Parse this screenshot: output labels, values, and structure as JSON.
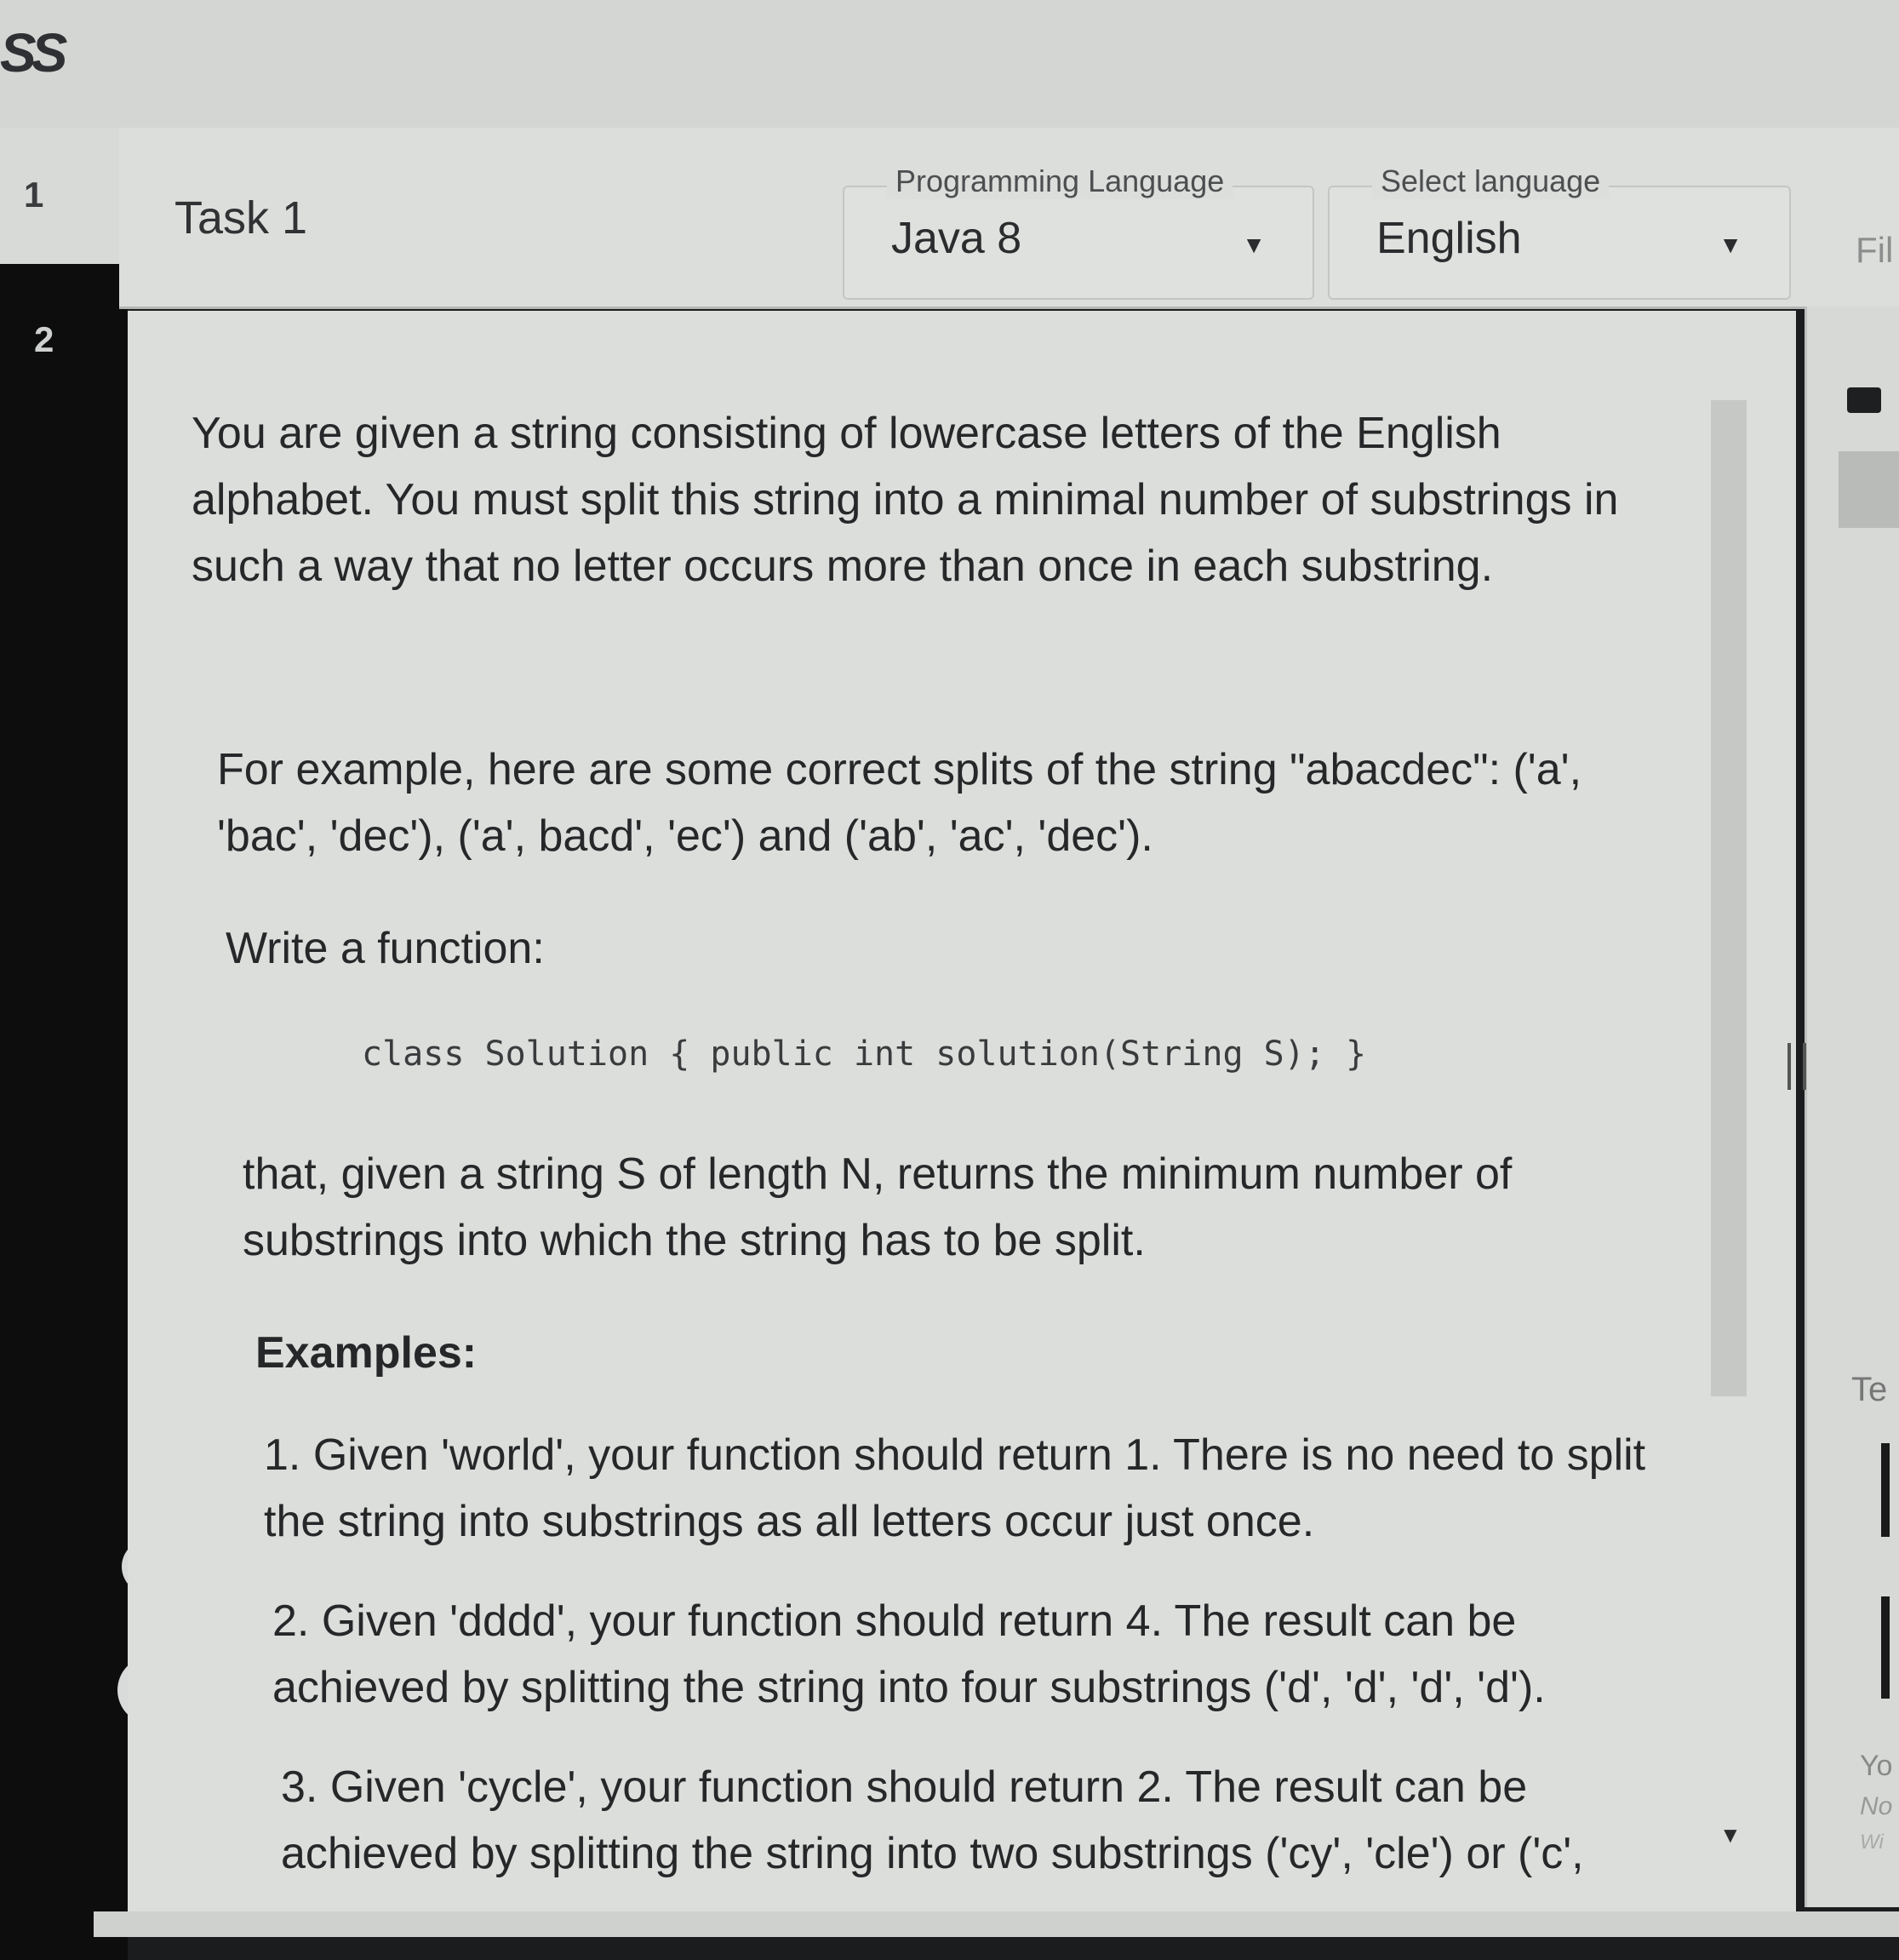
{
  "app": {
    "logo": "SS"
  },
  "tasks": [
    {
      "number": "1",
      "active": true
    },
    {
      "number": "2",
      "active": false
    }
  ],
  "header": {
    "task_title": "Task 1",
    "programming_language": {
      "label": "Programming Language",
      "value": "Java 8"
    },
    "select_language": {
      "label": "Select language",
      "value": "English"
    },
    "right_label": "Fil"
  },
  "problem": {
    "para1": "You are given a string consisting of lowercase letters of the English alphabet. You must split this string into a minimal number of substrings in such a way that no letter occurs more than once in each substring.",
    "para2": "For example, here are some correct splits of the string \"abacdec\": ('a', 'bac', 'dec'), ('a', bacd', 'ec') and ('ab', 'ac', 'dec').",
    "para3": "Write a function:",
    "code": "class Solution { public int solution(String S); }",
    "para4": "that, given a string S of length N, returns the minimum number of substrings into which the string has to be split.",
    "examples_heading": "Examples:",
    "example1": "1. Given 'world', your function should return 1. There is no need to split the string into substrings as all letters occur just once.",
    "example2": "2. Given 'dddd', your function should return 4. The result can be achieved by splitting the string into four substrings ('d', 'd', 'd', 'd').",
    "example3": "3. Given 'cycle', your function should return 2. The result can be achieved by splitting the string into two substrings ('cy', 'cle') or ('c',"
  },
  "sidebar_icons": {
    "accessibility": "accessibility-icon",
    "help": "?",
    "exit": "→]"
  },
  "right_panel": {
    "te": "Te",
    "yo": "Yo",
    "no": "No",
    "wi": "Wi"
  }
}
